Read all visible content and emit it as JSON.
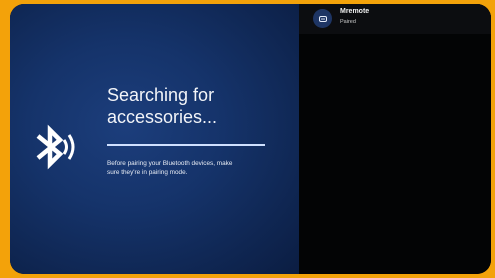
{
  "pairing": {
    "title_line1": "Searching for",
    "title_line2": "accessories...",
    "hint_line1": "Before pairing your Bluetooth devices, make",
    "hint_line2": "sure they're in pairing mode.",
    "progress_fraction": 1.0,
    "icon": "bluetooth-searching-icon"
  },
  "devices": [
    {
      "name": "Mremote",
      "status": "Paired",
      "icon": "remote-icon"
    }
  ],
  "colors": {
    "frame": "#f3a20a",
    "panel": "#15336a",
    "accent": "#cfe0ff"
  }
}
